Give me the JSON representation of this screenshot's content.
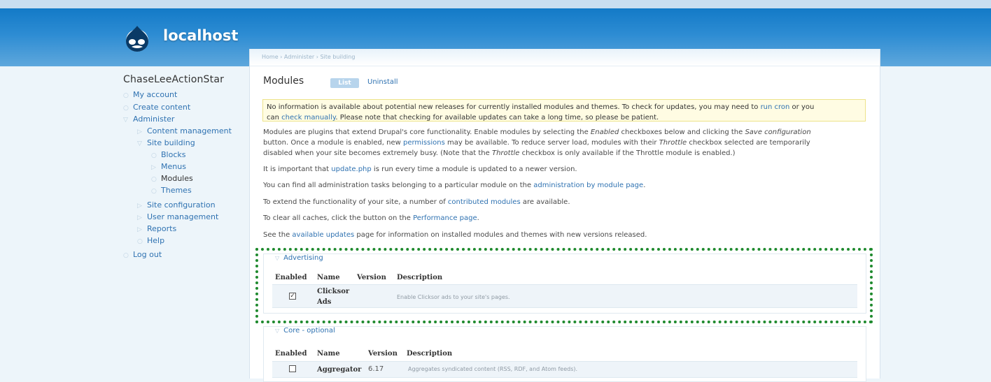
{
  "site": {
    "name": "localhost"
  },
  "sidebar": {
    "title": "ChaseLeeActionStar",
    "items": [
      {
        "label": "My account"
      },
      {
        "label": "Create content"
      },
      {
        "label": "Administer"
      },
      {
        "label": "Content management"
      },
      {
        "label": "Site building"
      },
      {
        "label": "Blocks"
      },
      {
        "label": "Menus"
      },
      {
        "label": "Modules"
      },
      {
        "label": "Themes"
      },
      {
        "label": "Site configuration"
      },
      {
        "label": "User management"
      },
      {
        "label": "Reports"
      },
      {
        "label": "Help"
      },
      {
        "label": "Log out"
      }
    ]
  },
  "breadcrumb": {
    "home": "Home",
    "sep": "›",
    "administer": "Administer",
    "site_building": "Site building"
  },
  "page": {
    "title": "Modules",
    "tab_list": "List",
    "tab_uninstall": "Uninstall"
  },
  "notice": {
    "t1": "No information is available about potential new releases for currently installed modules and themes. To check for updates, you may need to ",
    "l1": "run cron",
    "t2": " or you",
    "t3": "can ",
    "l2": "check manually",
    "t4": ". Please note that checking for available updates can take a long time, so please be patient."
  },
  "intro": {
    "t1": "Modules are plugins that extend Drupal's core functionality. Enable modules by selecting the ",
    "em1": "Enabled",
    "t2": " checkboxes below and clicking the ",
    "em2": "Save configuration",
    "t3": "button. Once a module is enabled, new ",
    "l1": "permissions",
    "t4": " may be available. To reduce server load, modules with their ",
    "em3": "Throttle",
    "t5": " checkbox selected are temporarily",
    "t6": "disabled when your site becomes extremely busy. (Note that the ",
    "em4": "Throttle",
    "t7": " checkbox is only available if the Throttle module is enabled.)"
  },
  "p_update": {
    "t1": "It is important that ",
    "l1": "update.php",
    "t2": " is run every time a module is updated to a newer version."
  },
  "p_admin": {
    "t1": "You can find all administration tasks belonging to a particular module on the ",
    "l1": "administration by module page",
    "t2": "."
  },
  "p_contrib": {
    "t1": "To extend the functionality of your site, a number of ",
    "l1": "contributed modules",
    "t2": " are available."
  },
  "p_cache": {
    "t1": "To clear all caches, click the button on the ",
    "l1": "Performance page",
    "t2": "."
  },
  "p_avail": {
    "t1": "See the ",
    "l1": "available updates",
    "t2": " page for information on installed modules and themes with new versions released."
  },
  "table_headers": {
    "enabled": "Enabled",
    "name": "Name",
    "version": "Version",
    "description": "Description"
  },
  "fieldsets": [
    {
      "legend": "Advertising",
      "rows": [
        {
          "checked": true,
          "name_line1": "Clicksor",
          "name_line2": "Ads",
          "version": "",
          "description": "Enable Clicksor ads to your site's pages."
        }
      ]
    },
    {
      "legend": "Core - optional",
      "rows": [
        {
          "checked": false,
          "name": "Aggregator",
          "version": "6.17",
          "description": "Aggregates syndicated content (RSS, RDF, and Atom feeds)."
        }
      ]
    }
  ],
  "colors": {
    "header": "#2d8cd3",
    "link": "#2f72b1",
    "notice_bg": "#fffce3",
    "highlight": "#1f8a2e"
  }
}
